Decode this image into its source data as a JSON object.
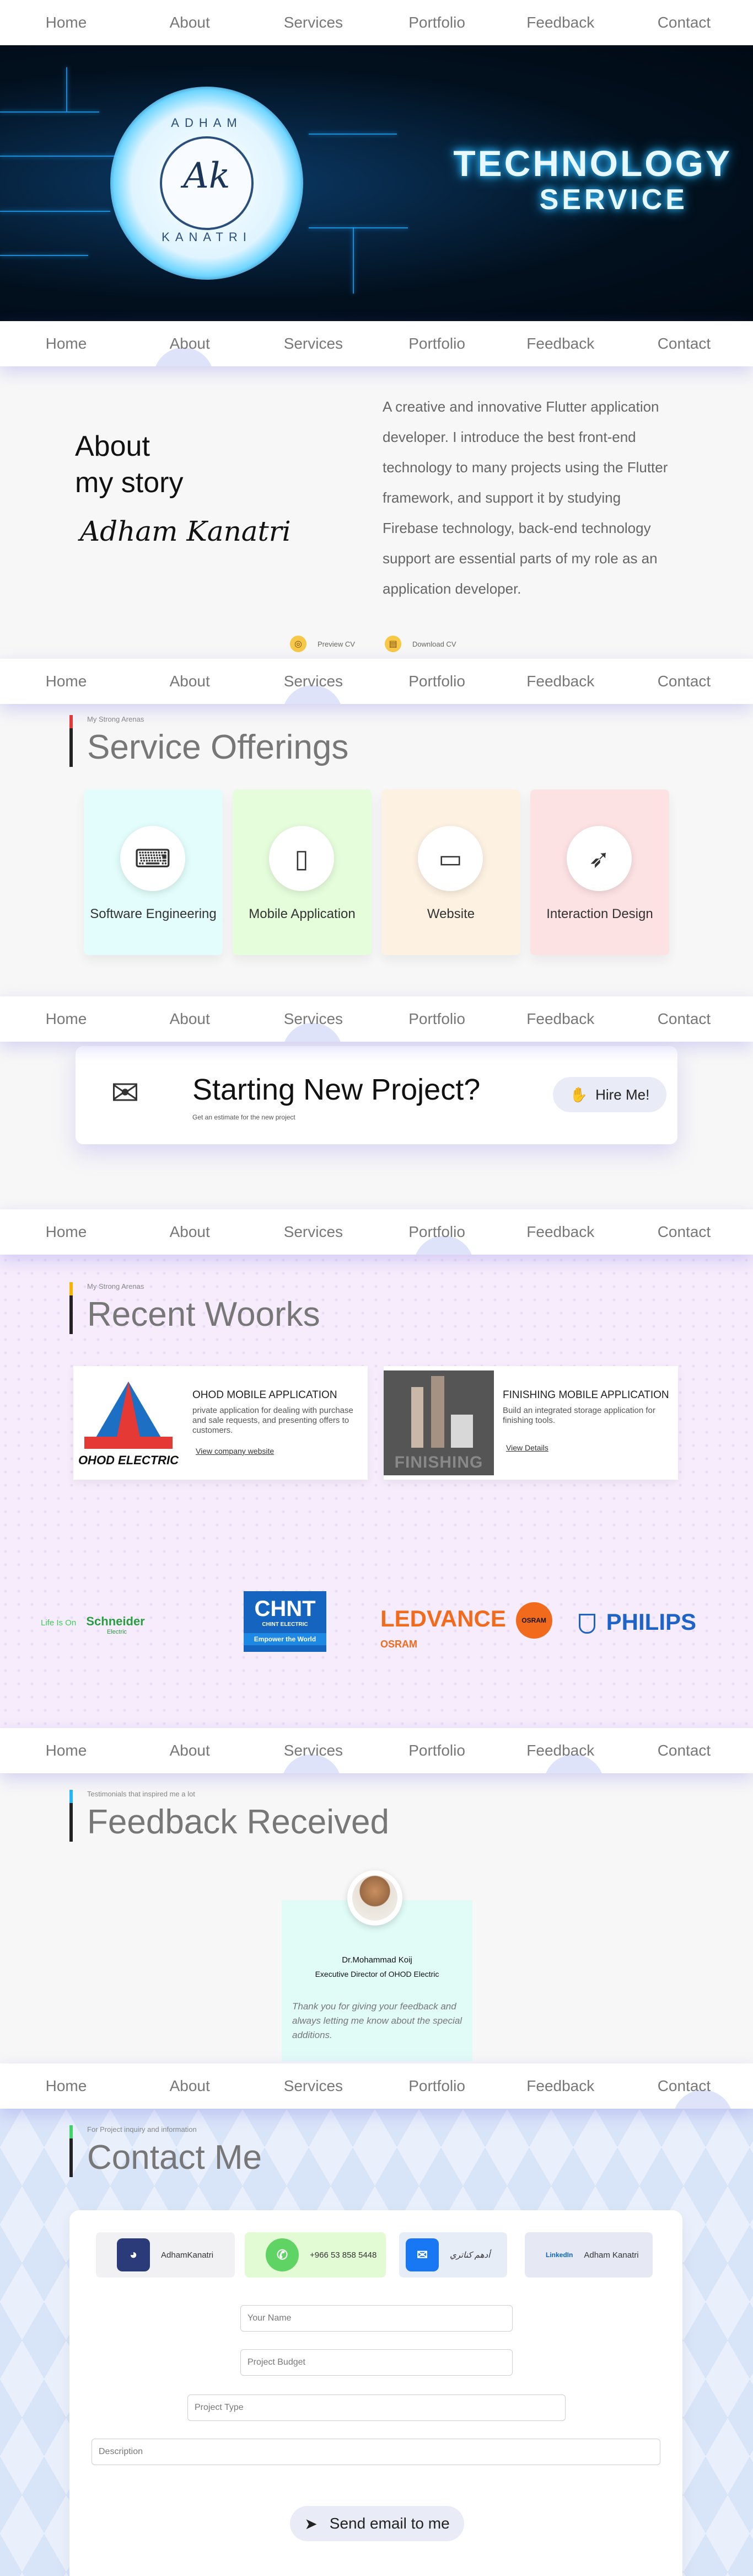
{
  "nav": {
    "items": [
      "Home",
      "About",
      "Services",
      "Portfolio",
      "Feedback",
      "Contact"
    ]
  },
  "hero": {
    "logo_top": "ADHAM",
    "logo_mark": "Ak",
    "logo_bottom": "KANATRI",
    "title_line1": "TECHNOLOGY",
    "title_line2": "SERVICE"
  },
  "about": {
    "title_line1": "About",
    "title_line2": "my story",
    "signature": "Adham Kanatri",
    "text": "A creative and innovative Flutter application developer. I introduce the best front-end technology to many projects using the Flutter framework, and support it by studying Firebase technology, back-end technology support are essential parts of my role as an application developer.",
    "preview_cv": "Preview CV",
    "download_cv": "Download CV"
  },
  "services": {
    "subtitle": "My Strong Arenas",
    "title": "Service Offerings",
    "cards": [
      {
        "label": "Software Engineering",
        "icon": "code-window-icon",
        "bg": "#e2fdfb"
      },
      {
        "label": "Mobile Application",
        "icon": "mobile-app-icon",
        "bg": "#e6fddc"
      },
      {
        "label": "Website",
        "icon": "monitor-icon",
        "bg": "#fdf2e2"
      },
      {
        "label": "Interaction Design",
        "icon": "rocket-icon",
        "bg": "#fde2e4"
      }
    ]
  },
  "start_project": {
    "title": "Starting New Project?",
    "subtitle": "Get an estimate for the new project",
    "button": "Hire Me!",
    "icon": "envelope-icon"
  },
  "works": {
    "subtitle": "My Strong Arenas",
    "title": "Recent Woorks",
    "cards": [
      {
        "title": "OHOD MOBILE APPLICATION",
        "desc": "private application for dealing with purchase and sale requests, and presenting offers to customers.",
        "link": "View company website",
        "thumb_text": "OHOD ELECTRIC"
      },
      {
        "title": "FINISHING MOBILE APPLICATION",
        "desc": "Build an integrated storage application for finishing tools.",
        "link": "View Details",
        "thumb_text": "FINISHING"
      }
    ],
    "brands": {
      "schneider_tag": "Life Is On",
      "schneider": "Schneider",
      "schneider_sub": "Electric",
      "chint": "CHNT",
      "chint_sub": "CHINT ELECTRIC",
      "chint_tag": "Empower the World",
      "ledvance": "LEDVANCE",
      "osram": "OSRAM",
      "osram_badge": "OSRAM",
      "philips": "PHILIPS"
    }
  },
  "feedback": {
    "subtitle": "Testimonials that inspired me a lot",
    "title": "Feedback Received",
    "name": "Dr.Mohammad Koij",
    "role": "Executive Director of OHOD Electric",
    "quote": "Thank you for giving your feedback and always letting me know about the special additions."
  },
  "contact": {
    "subtitle": "For Project inquiry and information",
    "title": "Contact Me",
    "socials": [
      {
        "label": "AdhamKanatri",
        "icon": "github-icon",
        "bg": "#f1f1f3",
        "icon_bg": "#2b3a78"
      },
      {
        "label": "+966 53 858 5448",
        "icon": "whatsapp-icon",
        "bg": "#e3fbd5",
        "icon_bg": "#5fd363"
      },
      {
        "label": "أدهم كناتري",
        "icon": "messenger-icon",
        "bg": "#e7edf7",
        "icon_bg": "#1877f2"
      },
      {
        "label": "Adham Kanatri",
        "icon": "linkedin-icon",
        "bg": "#e6e8f3",
        "icon_text": "LinkedIn"
      }
    ],
    "name_placeholder": "Your Name",
    "budget_placeholder": "Project Budget",
    "type_placeholder": "Project Type",
    "desc_placeholder": "Description",
    "send": "Send email to me"
  },
  "colors": {
    "services_accent": "#e53935",
    "works_accent": "#f5b400",
    "feedback_accent": "#29b6f6",
    "contact_accent": "#43d36b"
  }
}
